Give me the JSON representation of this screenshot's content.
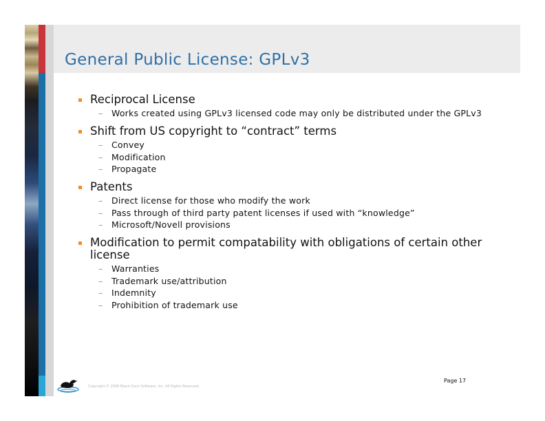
{
  "slide": {
    "title": "General Public License: GPLv3",
    "bullets": [
      {
        "text": "Reciprocal License",
        "subs": [
          "Works created using GPLv3 licensed code may only be distributed under the GPLv3"
        ]
      },
      {
        "text": "Shift from US copyright to “contract” terms",
        "subs": [
          "Convey",
          "Modification",
          "Propagate"
        ]
      },
      {
        "text": "Patents",
        "subs": [
          "Direct license for those who modify the work",
          "Pass through of third party patent licenses if used with “knowledge”",
          "Microsoft/Novell provisions"
        ]
      },
      {
        "text": "Modification to permit compatability with obligations of certain other license",
        "subs": [
          "Warranties",
          "Trademark use/attribution",
          "Indemnity",
          "Prohibition of trademark use"
        ]
      }
    ],
    "footer": {
      "copyright": "Copyright © 2008 Black Duck Software, Inc. All Rights Reserved.",
      "page": "Page 17",
      "logo_icon": "duck-logo-icon"
    },
    "colors": {
      "title": "#2e6fa7",
      "bullet_square": "#f28c28",
      "sub_dash": "#e07a1f",
      "red_bar": "#c8333c",
      "blue_bar": "#1b70a8",
      "title_band": "#ececec"
    }
  }
}
